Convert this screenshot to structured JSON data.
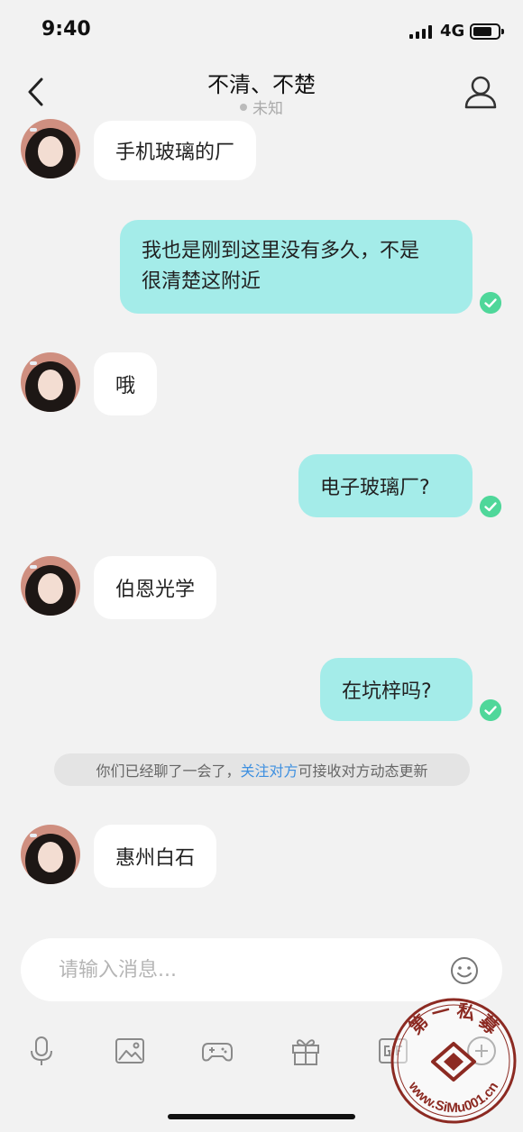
{
  "status_bar": {
    "time": "9:40",
    "network": "4G"
  },
  "header": {
    "title": "不清、不楚",
    "subtitle": "未知"
  },
  "messages": [
    {
      "side": "in",
      "text": "手机玻璃的厂"
    },
    {
      "side": "out",
      "line1": "我也是刚到这里没有多久，不是",
      "line2": "很清楚这附近"
    },
    {
      "side": "in",
      "text": "哦"
    },
    {
      "side": "out",
      "text": "电子玻璃厂?"
    },
    {
      "side": "in",
      "text": "伯恩光学"
    },
    {
      "side": "out",
      "text": "在坑梓吗?"
    },
    {
      "side": "in",
      "text": "惠州白石"
    }
  ],
  "notice": {
    "before": "你们已经聊了一会了，",
    "link": "关注对方",
    "after": "可接收对方动态更新"
  },
  "input": {
    "placeholder": "请输入消息...",
    "value": ""
  },
  "toolbar": [
    "mic-icon",
    "image-icon",
    "game-icon",
    "gift-icon",
    "gif-icon",
    "plus-icon"
  ],
  "watermark": {
    "text_top": "第 一 私 募",
    "text_bottom": "www.SiMu001.cn"
  },
  "colors": {
    "outgoing_bubble": "#a4ece9",
    "incoming_bubble": "#ffffff",
    "read_check": "#4fd79a",
    "link": "#3d8fe0",
    "background": "#f2f2f2"
  }
}
